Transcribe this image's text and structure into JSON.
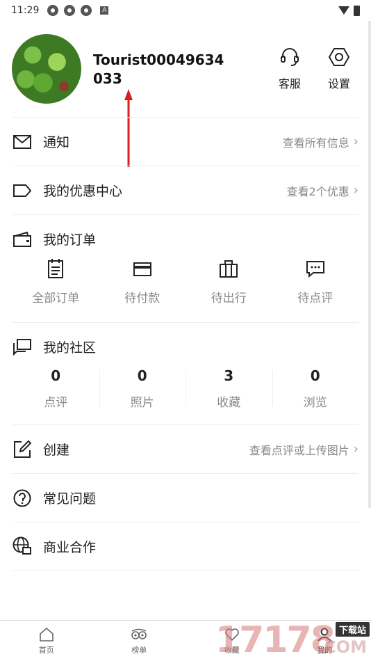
{
  "status_bar": {
    "time": "11:29",
    "badge": "A"
  },
  "profile": {
    "username": "Tourist00049634033",
    "customer_service_label": "客服",
    "settings_label": "设置"
  },
  "rows": {
    "notifications": {
      "title": "通知",
      "link": "查看所有信息"
    },
    "coupons": {
      "title": "我的优惠中心",
      "link": "查看2个优惠"
    },
    "orders": {
      "title": "我的订单"
    },
    "community": {
      "title": "我的社区"
    },
    "create": {
      "title": "创建",
      "link": "查看点评或上传图片"
    },
    "faq": {
      "title": "常见问题"
    },
    "business": {
      "title": "商业合作"
    }
  },
  "orders": [
    {
      "label": "全部订单",
      "icon": "clipboard-icon"
    },
    {
      "label": "待付款",
      "icon": "card-icon"
    },
    {
      "label": "待出行",
      "icon": "suitcase-icon"
    },
    {
      "label": "待点评",
      "icon": "comment-icon"
    }
  ],
  "community_stats": [
    {
      "value": "0",
      "label": "点评"
    },
    {
      "value": "0",
      "label": "照片"
    },
    {
      "value": "3",
      "label": "收藏"
    },
    {
      "value": "0",
      "label": "浏览"
    }
  ],
  "tabbar": [
    {
      "label": "首页",
      "icon": "home-icon"
    },
    {
      "label": "榜单",
      "icon": "owl-icon"
    },
    {
      "label": "收藏",
      "icon": "heart-icon"
    },
    {
      "label": "我的",
      "icon": "user-icon"
    }
  ],
  "watermark": {
    "number": "17178",
    "tag": "下载站",
    "suffix": ".COM"
  },
  "colors": {
    "text": "#222222",
    "secondary": "#888888",
    "divider": "#eeeeee",
    "arrow": "#d62020"
  }
}
